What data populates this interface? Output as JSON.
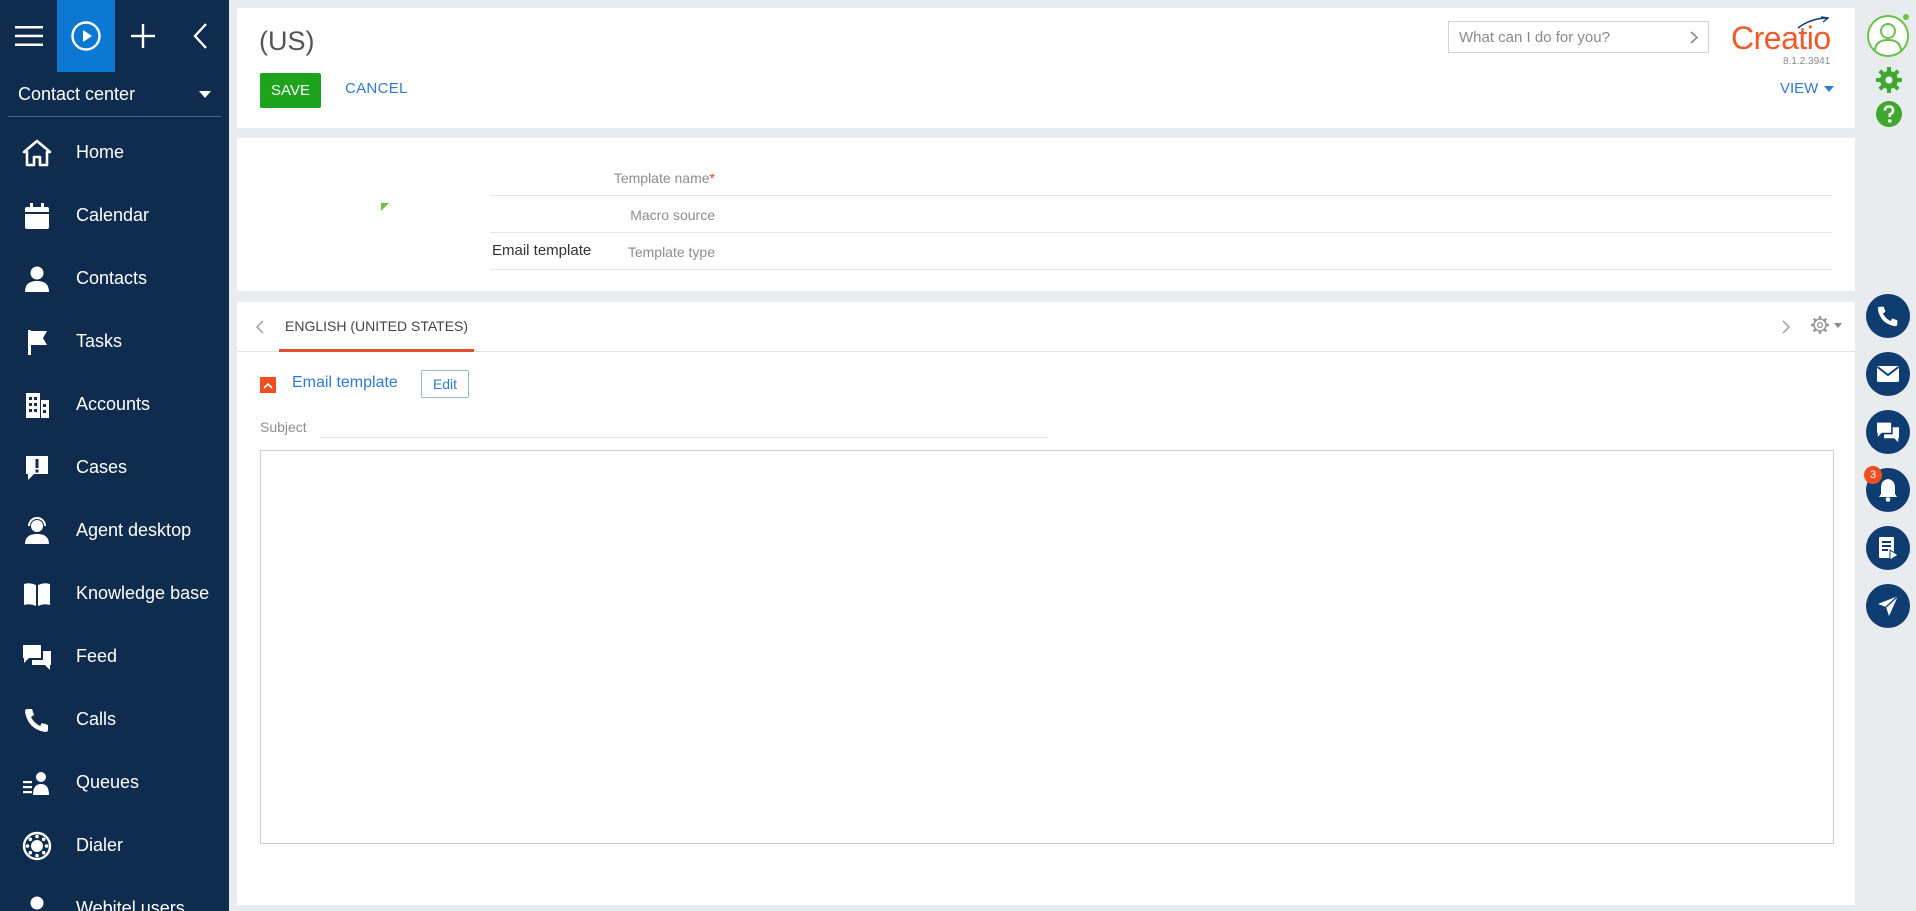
{
  "sidebar": {
    "workspace": "Contact center",
    "items": [
      {
        "label": "Home",
        "icon": "home-icon"
      },
      {
        "label": "Calendar",
        "icon": "calendar-icon"
      },
      {
        "label": "Contacts",
        "icon": "person-icon"
      },
      {
        "label": "Tasks",
        "icon": "flag-icon"
      },
      {
        "label": "Accounts",
        "icon": "building-icon"
      },
      {
        "label": "Cases",
        "icon": "case-alert-icon"
      },
      {
        "label": "Agent desktop",
        "icon": "agent-icon"
      },
      {
        "label": "Knowledge base",
        "icon": "book-icon"
      },
      {
        "label": "Feed",
        "icon": "chat-icon"
      },
      {
        "label": "Calls",
        "icon": "phone-icon"
      },
      {
        "label": "Queues",
        "icon": "queue-icon"
      },
      {
        "label": "Dialer",
        "icon": "dialer-icon"
      },
      {
        "label": "Webitel users",
        "icon": "user-icon"
      }
    ]
  },
  "header": {
    "title": "(US)",
    "save_label": "SAVE",
    "cancel_label": "CANCEL",
    "search_placeholder": "What can I do for you?",
    "logo": "Creatio",
    "version": "8.1.2.3941",
    "view_label": "VIEW"
  },
  "form": {
    "template_name_label": "Template name",
    "template_name_value": "",
    "macro_source_label": "Macro source",
    "macro_source_value": "",
    "template_type_label": "Template type",
    "template_type_value": "Email template"
  },
  "tabs": {
    "active": "ENGLISH (UNITED STATES)"
  },
  "email_group": {
    "title": "Email template",
    "edit_label": "Edit",
    "subject_label": "Subject",
    "subject_value": ""
  },
  "right_rail": {
    "notification_count": "3"
  },
  "colors": {
    "sidebar_bg": "#0f2c4e",
    "active_tool": "#0b78d1",
    "save_green": "#1da31d",
    "accent_orange": "#ef4f20",
    "link_blue": "#2d7ad6",
    "rail_blue": "#0f3d72"
  }
}
